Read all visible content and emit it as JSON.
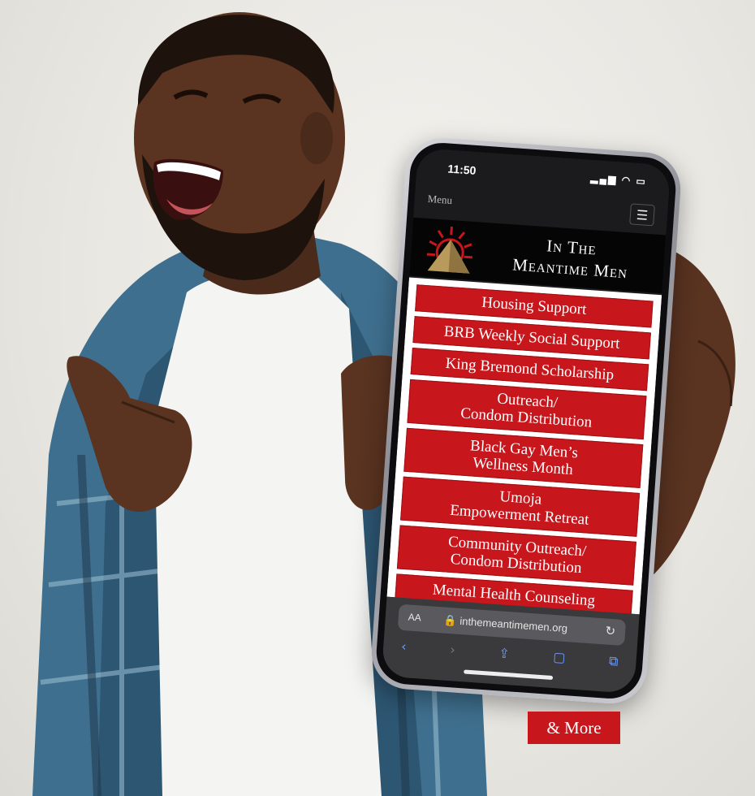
{
  "phone": {
    "status_time": "11:50",
    "menu_label": "Menu",
    "hamburger_icon": "hamburger-menu-icon",
    "logo": {
      "line1": "In The",
      "line2": "Meantime Men"
    },
    "menu_items": [
      "Housing Support",
      "BRB Weekly Social Support",
      "King Bremond Scholarship",
      "Outreach/\nCondom Distribution",
      "Black Gay Men’s\nWellness Month",
      "Umoja\nEmpowerment Retreat",
      "Community Outreach/\nCondom Distribution",
      "Mental Health Counseling"
    ],
    "browser": {
      "aa_label": "AA",
      "url": "inthemeantimemen.org"
    }
  },
  "more_label": "& More",
  "colors": {
    "accent_red": "#c8161d",
    "logo_bar": "#050505"
  }
}
